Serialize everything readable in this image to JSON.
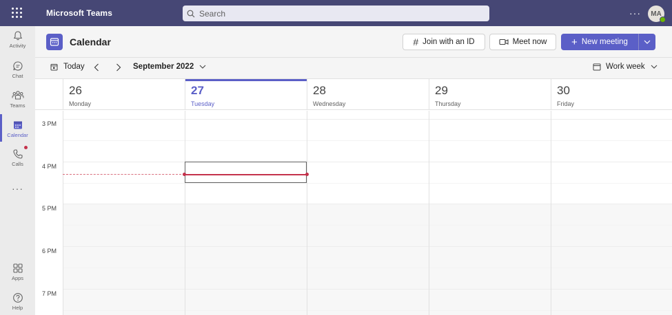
{
  "app": {
    "title": "Microsoft Teams"
  },
  "search": {
    "placeholder": "Search"
  },
  "user": {
    "initials": "MA",
    "status": "available"
  },
  "rail": {
    "items": [
      {
        "label": "Activity",
        "icon": "bell-icon"
      },
      {
        "label": "Chat",
        "icon": "chat-icon"
      },
      {
        "label": "Teams",
        "icon": "teams-icon"
      },
      {
        "label": "Calendar",
        "icon": "calendar-icon",
        "active": true
      },
      {
        "label": "Calls",
        "icon": "phone-icon",
        "notification": true
      },
      {
        "label": "",
        "icon": "more-icon"
      }
    ],
    "bottom": [
      {
        "label": "Apps",
        "icon": "apps-icon"
      },
      {
        "label": "Help",
        "icon": "help-icon"
      }
    ]
  },
  "header": {
    "title": "Calendar",
    "join_label": "Join with an ID",
    "meet_label": "Meet now",
    "new_meeting_label": "New meeting"
  },
  "toolbar": {
    "today_label": "Today",
    "month_label": "September 2022",
    "view_label": "Work week"
  },
  "days": [
    {
      "num": "26",
      "name": "Monday"
    },
    {
      "num": "27",
      "name": "Tuesday",
      "today": true
    },
    {
      "num": "28",
      "name": "Wednesday"
    },
    {
      "num": "29",
      "name": "Thursday"
    },
    {
      "num": "30",
      "name": "Friday"
    }
  ],
  "times": [
    "3 PM",
    "4 PM",
    "5 PM",
    "6 PM",
    "7 PM"
  ],
  "colors": {
    "brand": "#464775",
    "accent": "#5b5fc7",
    "now": "#c4314b"
  }
}
